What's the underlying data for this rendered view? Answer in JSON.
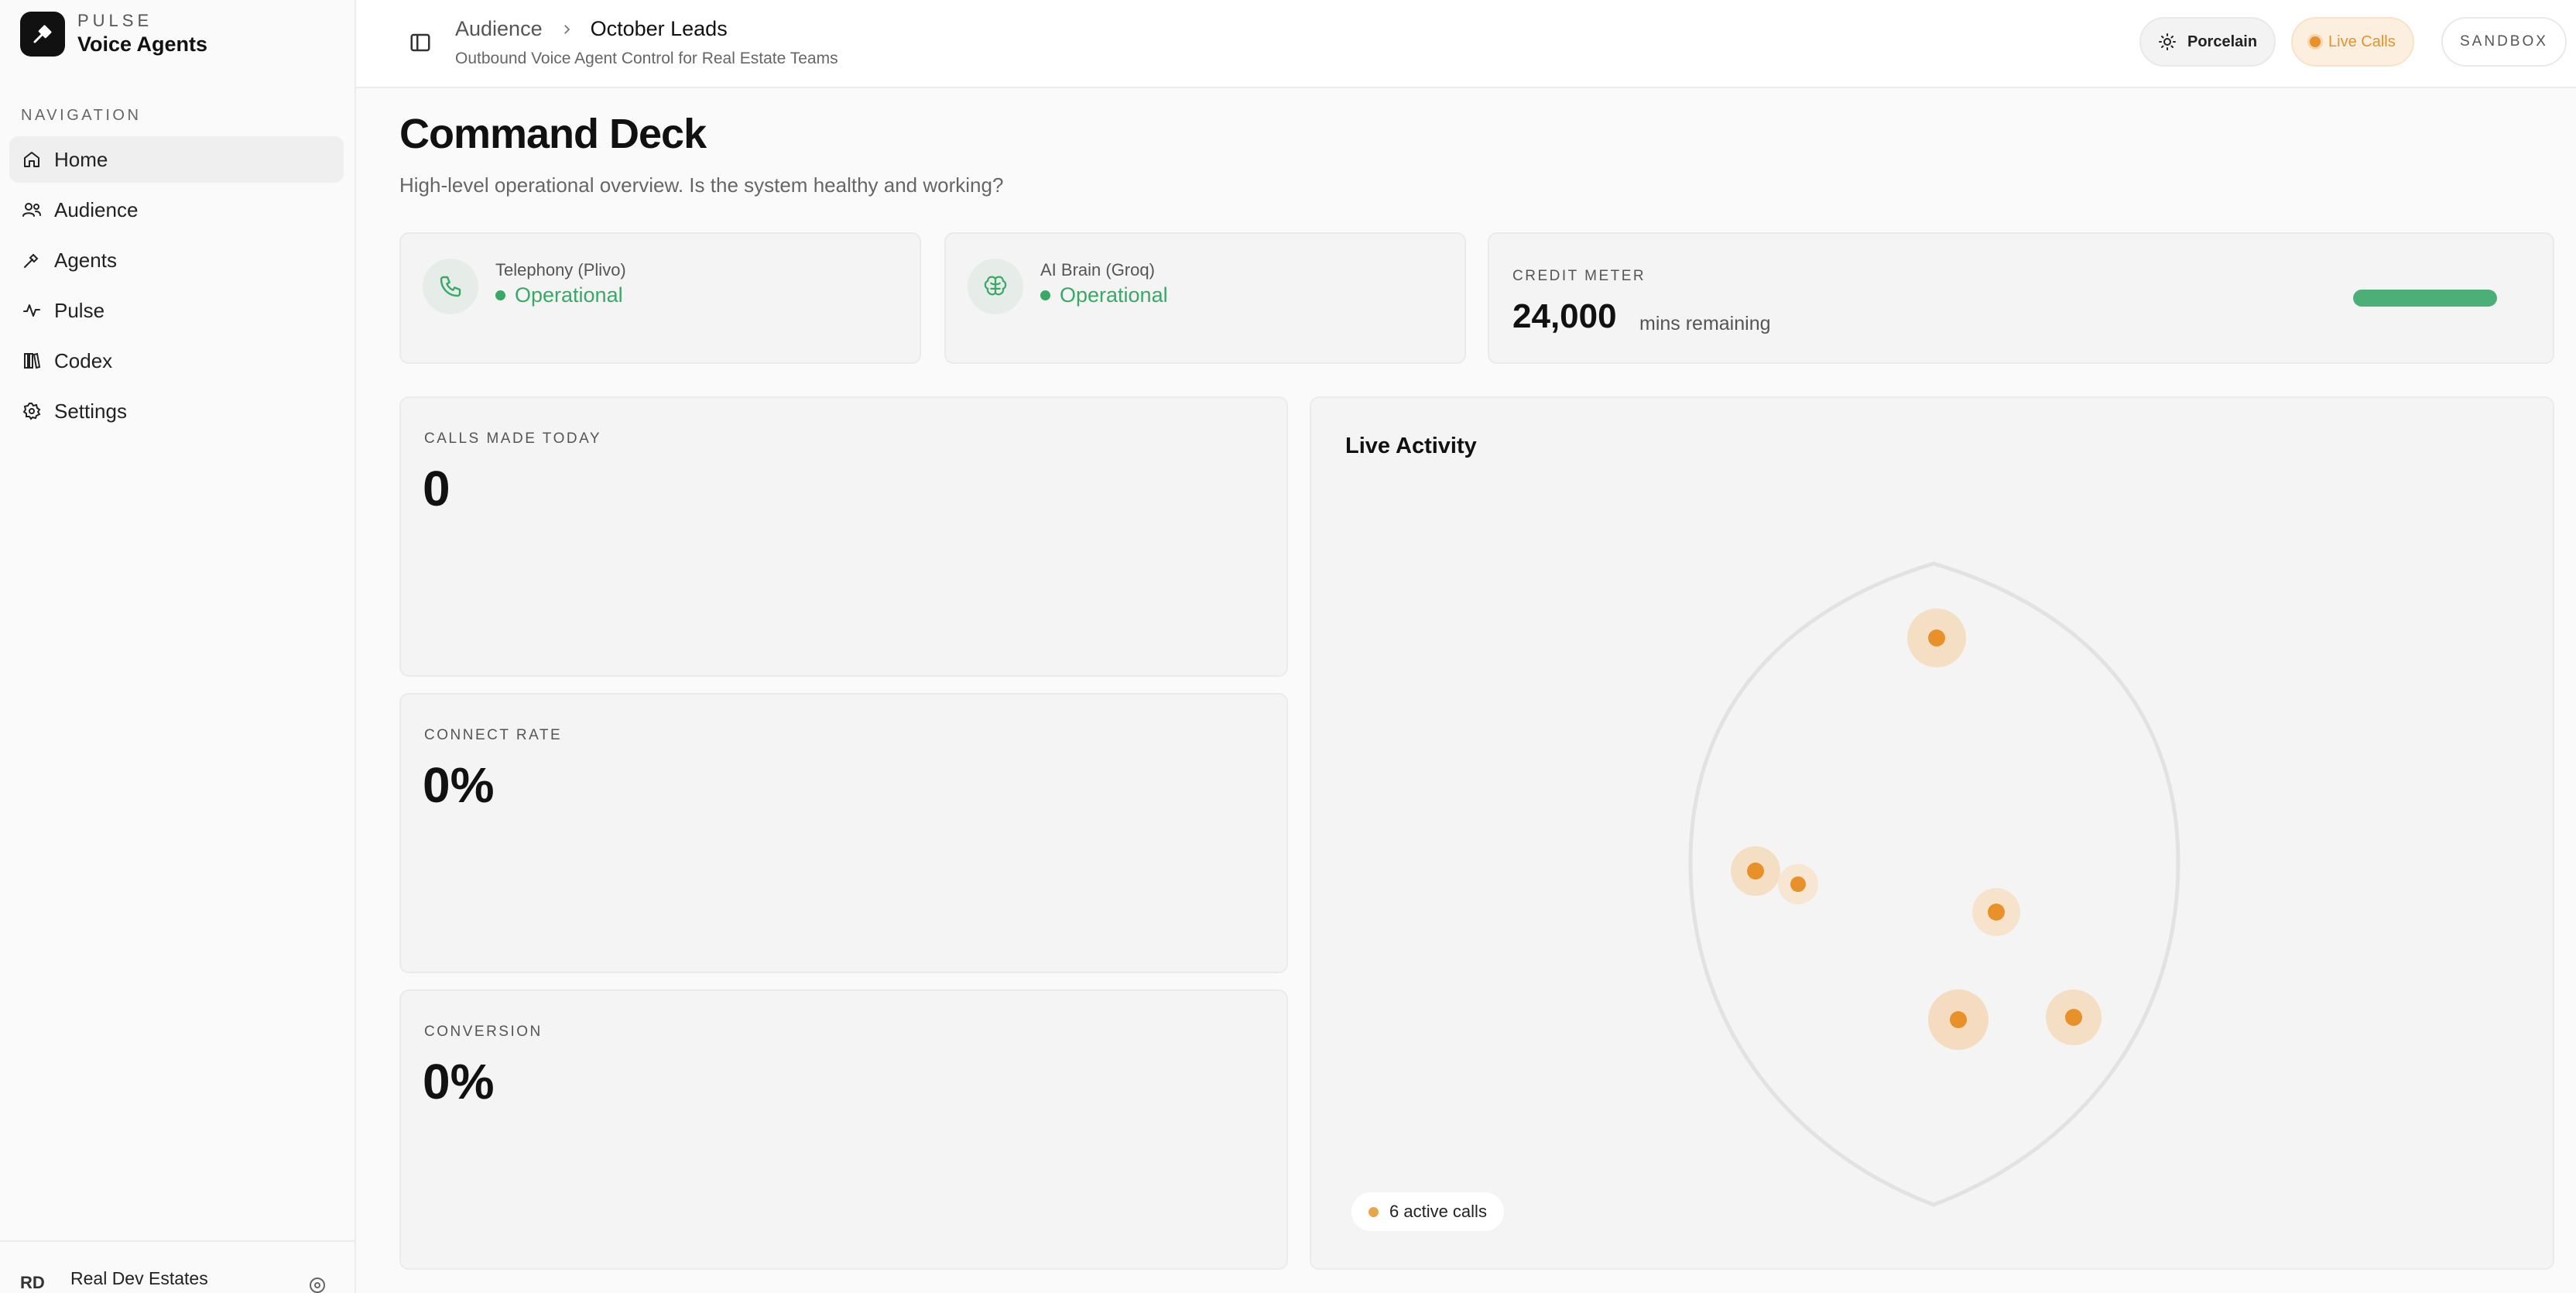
{
  "brand": {
    "kicker": "PULSE",
    "name": "Voice Agents"
  },
  "nav": {
    "heading": "NAVIGATION",
    "items": [
      {
        "label": "Home",
        "icon": "home-icon",
        "active": true
      },
      {
        "label": "Audience",
        "icon": "users-icon"
      },
      {
        "label": "Agents",
        "icon": "wand-icon"
      },
      {
        "label": "Pulse",
        "icon": "activity-icon"
      },
      {
        "label": "Codex",
        "icon": "library-icon"
      },
      {
        "label": "Settings",
        "icon": "gear-icon"
      }
    ]
  },
  "footer": {
    "avatar": "RD",
    "org": "Real Dev Estates"
  },
  "topbar": {
    "breadcrumb_parent": "Audience",
    "breadcrumb_current": "October Leads",
    "subtitle": "Outbound Voice Agent Control for Real Estate Teams",
    "theme_label": "Porcelain",
    "live_label": "Live Calls",
    "mode_label": "SANDBOX"
  },
  "page": {
    "title": "Command Deck",
    "description": "High-level operational overview. Is the system healthy and working?"
  },
  "status": {
    "telephony": {
      "label": "Telephony (Plivo)",
      "value": "Operational",
      "icon": "phone-icon"
    },
    "ai": {
      "label": "AI Brain (Groq)",
      "value": "Operational",
      "icon": "brain-icon"
    }
  },
  "credit": {
    "kicker": "CREDIT METER",
    "value": "24,000",
    "unit": "mins remaining",
    "fill_percent": 100
  },
  "metrics": [
    {
      "label": "CALLS MADE TODAY",
      "value": "0"
    },
    {
      "label": "CONNECT RATE",
      "value": "0%"
    },
    {
      "label": "CONVERSION",
      "value": "0%"
    }
  ],
  "live": {
    "title": "Live Activity",
    "active_calls": "6 active calls"
  },
  "colors": {
    "accent_orange": "#e8912a",
    "success_green": "#3aa866",
    "meter_green": "#4caf78"
  }
}
